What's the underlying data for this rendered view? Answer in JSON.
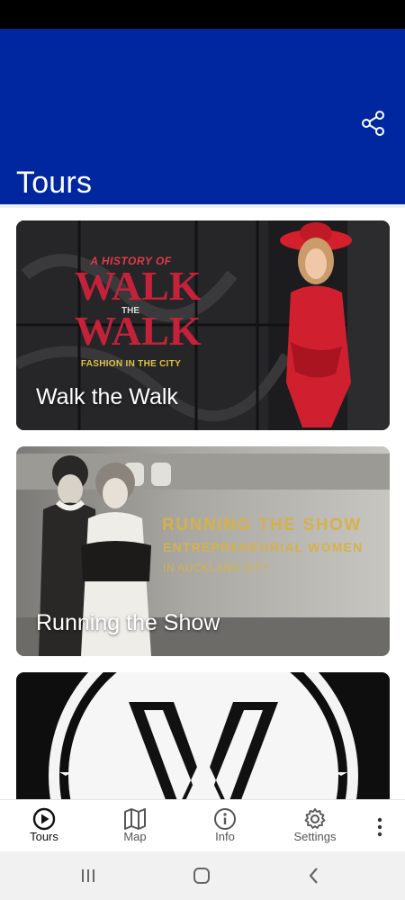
{
  "header": {
    "title": "Tours"
  },
  "tours": [
    {
      "title": "Walk the Walk",
      "poster": {
        "line1": "A HISTORY OF",
        "line2": "WALK",
        "line3": "THE",
        "line4": "WALK",
        "line5": "FASHION IN THE CITY"
      }
    },
    {
      "title": "Running the Show",
      "poster": {
        "line1": "RUNNING THE SHOW",
        "line2": "ENTREPRENEURIAL WOMEN",
        "line3": "IN AUCKLAND CITY"
      }
    },
    {
      "title": ""
    }
  ],
  "nav": {
    "items": [
      {
        "label": "Tours",
        "icon": "play-circle-icon",
        "active": true
      },
      {
        "label": "Map",
        "icon": "map-icon",
        "active": false
      },
      {
        "label": "Info",
        "icon": "info-icon",
        "active": false
      },
      {
        "label": "Settings",
        "icon": "gear-icon",
        "active": false
      }
    ],
    "more_icon": "more-vertical-icon"
  },
  "colors": {
    "app_bar": "#0027a0",
    "poster_red": "#c6213a",
    "poster_gold": "#d6b14a"
  }
}
